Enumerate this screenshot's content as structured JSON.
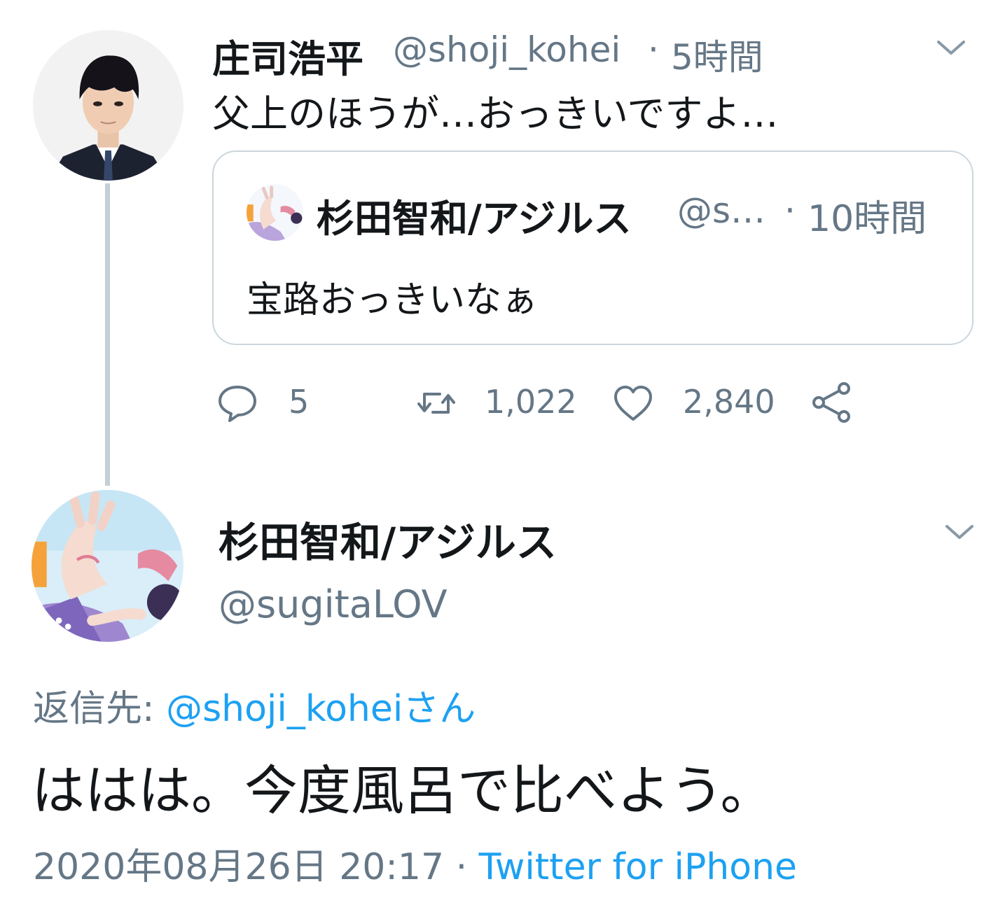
{
  "parent_tweet": {
    "display_name": "庄司浩平",
    "handle": "@shoji_kohei",
    "separator": "·",
    "time": "5時間",
    "text": "父上のほうが…おっきいですよ…",
    "quoted": {
      "display_name": "杉田智和/アジルス",
      "handle": "@s…",
      "separator": "·",
      "time": "10時間",
      "text": "宝路おっきいなぁ"
    },
    "actions": {
      "reply_count": "5",
      "retweet_count": "1,022",
      "like_count": "2,840"
    }
  },
  "reply_tweet": {
    "display_name": "杉田智和/アジルス",
    "handle": "@sugitaLOV",
    "reply_to_label": "返信先: ",
    "reply_to_user": "@shoji_koheiさん",
    "text": "ははは。今度風呂で比べよう。",
    "date": "2020年08月26日 20:17",
    "separator": " · ",
    "client": "Twitter for iPhone"
  },
  "icons": {
    "caret": "chevron-down-icon",
    "reply": "speech-bubble-icon",
    "retweet": "retweet-arrows-icon",
    "like": "heart-outline-icon",
    "share": "share-nodes-icon"
  },
  "colors": {
    "text": "#14171a",
    "muted": "#657786",
    "link": "#1da1f2",
    "border": "#ccd6dd",
    "thread_line": "#c4cfd6"
  }
}
